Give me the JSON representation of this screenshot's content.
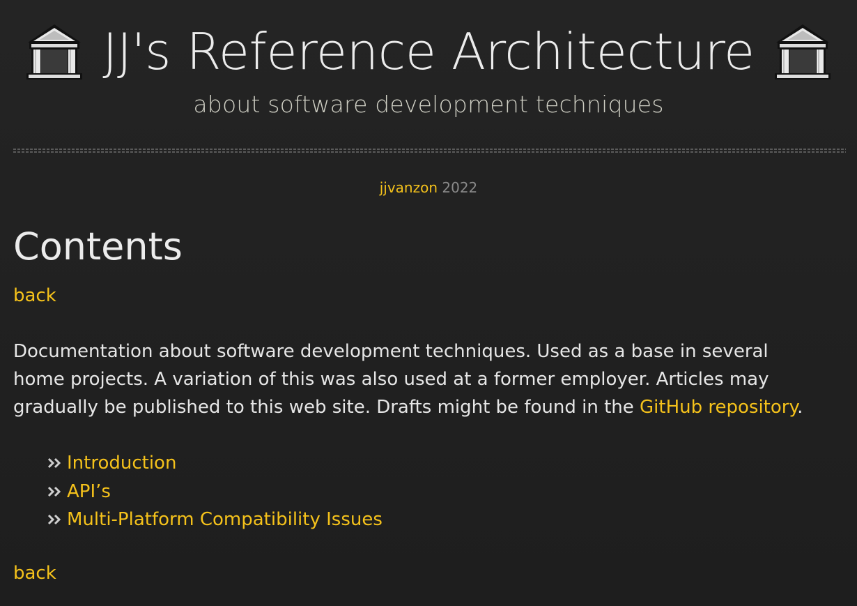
{
  "header": {
    "title": "JJ's Reference Architecture",
    "subtitle": "about software development techniques",
    "icon_left": "classical-building-icon",
    "icon_right": "classical-building-icon"
  },
  "byline": {
    "author": "jjvanzon",
    "year": "2022"
  },
  "page": {
    "title": "Contents",
    "back_top": "back",
    "back_bottom": "back",
    "intro_part1": "Documentation about software development techniques. Used as a base in several home projects. A variation of this was also used at a former employer. Articles may gradually be published to this web site. Drafts might be found in the ",
    "intro_link": "GitHub repository",
    "intro_part2": "."
  },
  "toc": [
    {
      "label": "Introduction",
      "bullet": "double-chevron-right-icon"
    },
    {
      "label": "API’s",
      "bullet": "double-chevron-right-icon"
    },
    {
      "label": "Multi-Platform Compatibility Issues",
      "bullet": "double-chevron-right-icon"
    }
  ],
  "colors": {
    "background": "#222222",
    "text": "#e6e6e6",
    "link": "#f5c21b",
    "muted": "#8a8a8a",
    "subtitle": "#cfcfc4"
  }
}
